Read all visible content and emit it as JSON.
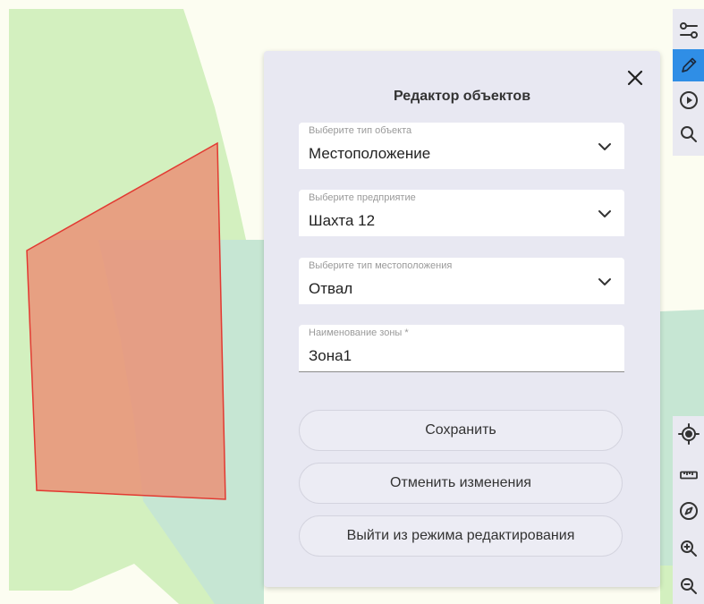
{
  "editor": {
    "title": "Редактор объектов",
    "fields": {
      "object_type": {
        "label": "Выберите тип объекта",
        "value": "Местоположение"
      },
      "enterprise": {
        "label": "Выберите предприятие",
        "value": "Шахта 12"
      },
      "location_type": {
        "label": "Выберите тип местоположения",
        "value": "Отвал"
      },
      "zone_name": {
        "label": "Наименование зоны *",
        "value": "Зона1"
      }
    },
    "buttons": {
      "save": "Сохранить",
      "cancel": "Отменить изменения",
      "exit": "Выйти из режима редактирования"
    }
  },
  "toolbar": {
    "top": [
      "layers-settings-icon",
      "pencil-icon",
      "play-icon",
      "search-icon"
    ],
    "active": "pencil-icon",
    "bottom": [
      "locate-icon",
      "ruler-icon",
      "compass-icon",
      "zoom-in-icon",
      "zoom-out-icon"
    ]
  },
  "colors": {
    "panel_bg": "#e8e8f2",
    "accent": "#2f8ee6",
    "polygon_fill": "#e9947a",
    "polygon_stroke": "#e23a32",
    "map_green": "#d3f0bf",
    "map_teal": "#c6e6d3",
    "map_cream": "#fcfdf1"
  }
}
